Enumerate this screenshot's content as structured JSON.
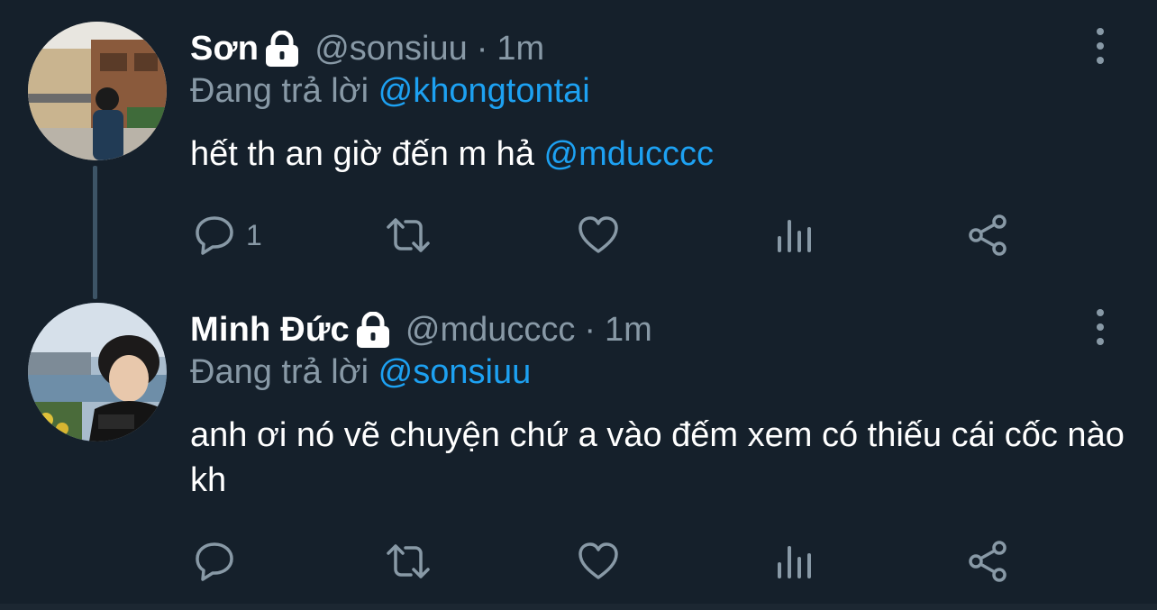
{
  "tweets": [
    {
      "name": "Sơn",
      "handle": "@sonsiuu",
      "separator": "·",
      "time": "1m",
      "reply_prefix": "Đang trả lời",
      "reply_to": "@khongtontai",
      "text": "hết th an giờ đến m hả",
      "text_mention": "@mducccc",
      "reply_count": "1",
      "icons": [
        "lock-icon",
        "reply-icon",
        "retweet-icon",
        "like-icon",
        "views-icon",
        "share-icon",
        "more-icon"
      ]
    },
    {
      "name": "Minh Đức",
      "handle": "@mducccc",
      "separator": "·",
      "time": "1m",
      "reply_prefix": "Đang trả lời",
      "reply_to": "@sonsiuu",
      "text": "anh ơi nó vẽ chuyện chứ a vào đếm xem có thiếu cái cốc nào kh",
      "text_mention": "",
      "reply_count": "",
      "icons": [
        "lock-icon",
        "reply-icon",
        "retweet-icon",
        "like-icon",
        "views-icon",
        "share-icon",
        "more-icon"
      ]
    }
  ],
  "colors": {
    "background": "#15202b",
    "text_primary": "#ffffff",
    "text_secondary": "#8899a6",
    "accent": "#1da1f2",
    "thread_line": "#3d5466"
  }
}
